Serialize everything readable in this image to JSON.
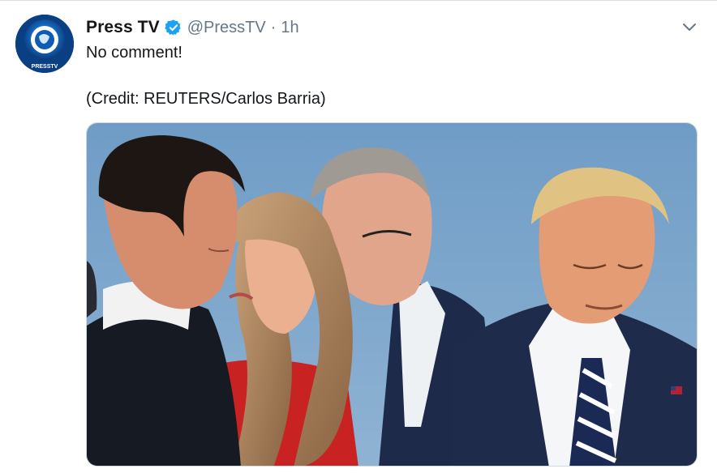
{
  "tweet": {
    "display_name": "Press TV",
    "handle": "@PressTV",
    "separator": "·",
    "time": "1h",
    "verified": true,
    "text_line1": "No comment!",
    "text_line2": "(Credit: REUTERS/Carlos Barria)"
  },
  "avatar": {
    "logo_text": "PRESSTV",
    "icon": "presstv-logo-icon"
  },
  "icons": {
    "verified": "verified-badge-icon",
    "more": "chevron-down-icon"
  },
  "colors": {
    "name": "#14171a",
    "secondary": "#657786",
    "verified_blue": "#1da1f2",
    "sky": "#7aa3c8"
  }
}
